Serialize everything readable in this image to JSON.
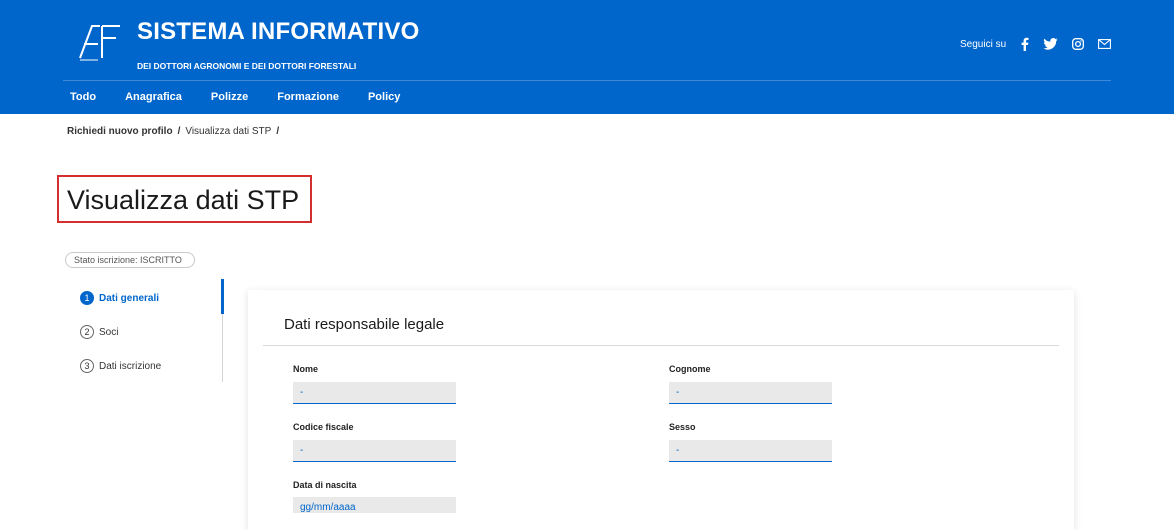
{
  "header": {
    "title": "SISTEMA INFORMATIVO",
    "subtitle": "DEI DOTTORI AGRONOMI E DEI DOTTORI FORESTALI",
    "bg_color": "#0066cc",
    "social_label": "Seguici su",
    "social_icons": [
      "facebook-icon",
      "twitter-icon",
      "instagram-icon",
      "mail-icon"
    ]
  },
  "nav": [
    "Todo",
    "Anagrafica",
    "Polizze",
    "Formazione",
    "Policy"
  ],
  "breadcrumb": {
    "item1": "Richiedi nuovo profilo",
    "item2": "Visualizza dati STP",
    "separator": "/"
  },
  "page": {
    "title": "Visualizza dati STP",
    "status": "Stato iscrizione: ISCRITTO",
    "highlight_color": "#d32f2f"
  },
  "steps": [
    {
      "num": "1",
      "label": "Dati generali",
      "active": true
    },
    {
      "num": "2",
      "label": "Soci",
      "active": false
    },
    {
      "num": "3",
      "label": "Dati iscrizione",
      "active": false
    }
  ],
  "section": {
    "title": "Dati responsabile legale",
    "fields": {
      "nome": {
        "label": "Nome",
        "value": "-"
      },
      "cognome": {
        "label": "Cognome",
        "value": "-"
      },
      "codice_fiscale": {
        "label": "Codice fiscale",
        "value": "-"
      },
      "sesso": {
        "label": "Sesso",
        "value": "-"
      },
      "data_nascita": {
        "label": "Data di nascita",
        "value": "gg/mm/aaaa"
      }
    }
  }
}
